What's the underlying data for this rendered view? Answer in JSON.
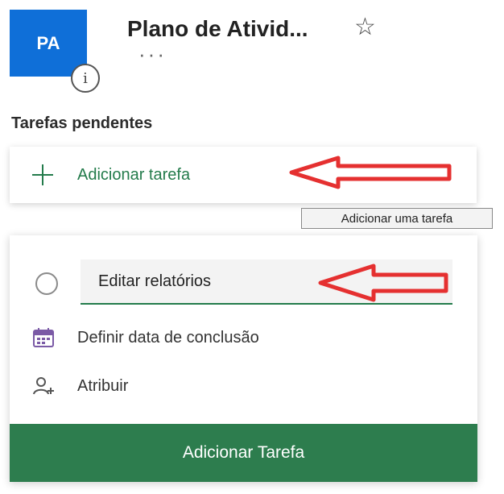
{
  "plan": {
    "avatar_initials": "PA",
    "title": "Plano de Ativid...",
    "more_glyph": "···",
    "star_glyph": "☆",
    "info_glyph": "i"
  },
  "section": {
    "heading": "Tarefas pendentes"
  },
  "add_task": {
    "label": "Adicionar tarefa",
    "tooltip": "Adicionar uma tarefa"
  },
  "new_task": {
    "title_value": "Editar relatórios",
    "due_date_label": "Definir data de conclusão",
    "assign_label": "Atribuir",
    "submit_label": "Adicionar Tarefa"
  },
  "colors": {
    "avatar_blue": "#0f6fd8",
    "accent_green": "#237b4b",
    "button_green": "#2d7d4e",
    "annotation_red": "#e53030",
    "calendar_purple": "#7b5aa6"
  },
  "icons": {
    "info": "info-icon",
    "star": "star-icon",
    "more": "more-icon",
    "plus": "plus-icon",
    "calendar": "calendar-icon",
    "assign": "person-add-icon",
    "arrow": "red-arrow-icon"
  }
}
